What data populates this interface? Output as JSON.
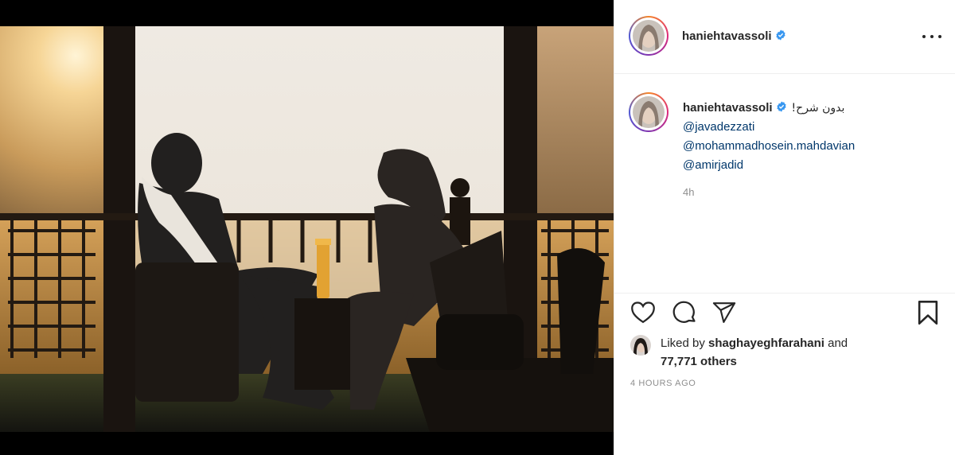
{
  "post": {
    "author": "haniehtavassoli",
    "verified": true,
    "caption": "بدون شرح!",
    "mentions": [
      "@javadezzati",
      "@mohammadhosein.mahdavian",
      "@amirjadid"
    ],
    "relative_time": "4h",
    "liked_by_prefix": "Liked by",
    "liked_by_user": "shaghayeghfarahani",
    "liked_by_and": "and",
    "others_count": "77,771 others",
    "timestamp": "4 HOURS AGO"
  },
  "icons": {
    "more": "more-options-icon",
    "like": "heart-icon",
    "comment": "comment-icon",
    "share": "share-icon",
    "save": "bookmark-icon",
    "verified": "verified-badge-icon"
  },
  "colors": {
    "verified_blue": "#3897f0",
    "mention_blue": "#00376b",
    "muted_text": "#8e8e8e",
    "border": "#efefef"
  }
}
